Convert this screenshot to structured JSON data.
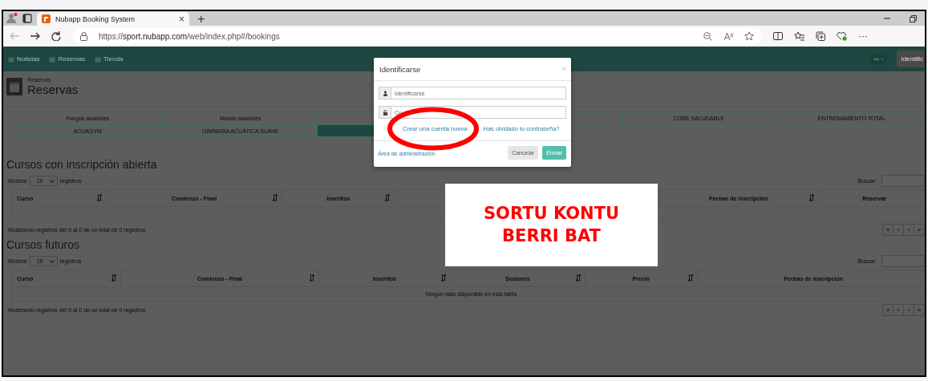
{
  "browser": {
    "tab": {
      "title": "Nubapp Booking System",
      "close": "×",
      "selected": true
    },
    "new_tab": "+",
    "address": {
      "scheme": "https://",
      "host": "sport.nubapp.com",
      "path": "/web/index.php#/bookings"
    },
    "menu": "···"
  },
  "nav": {
    "items": [
      {
        "label": "Noticias"
      },
      {
        "label": "Reservas"
      },
      {
        "label": "Tienda"
      }
    ],
    "login_button": "Identific"
  },
  "header": {
    "breadcrumb": "Reservas",
    "title": "Reservas"
  },
  "categories": [
    [
      {
        "label": "Fuegos asadores",
        "selected": false
      },
      {
        "label": "Mesas asadores",
        "selected": false
      },
      {
        "selected": false
      },
      {
        "selected": false
      },
      {
        "label": "CORE SALUDABLE",
        "selected": false
      },
      {
        "label": "ENTRENAMIENTO TOTAL",
        "selected": false
      }
    ],
    [
      {
        "label": "ACUAGYM",
        "selected": false
      },
      {
        "label": "GIMNASIA ACUÁTICA SUAVE",
        "selected": false
      },
      {
        "selected": true
      }
    ]
  ],
  "sections": [
    {
      "title": "Cursos con inscripción abierta",
      "show_label": "Mostrar",
      "page_size": "10",
      "records_label": "registros",
      "search_label": "Buscar:",
      "columns": [
        {
          "label": "Curso",
          "sortable": true
        },
        {
          "label": "Comienzo - Final",
          "sortable": true
        },
        {
          "label": "Inscritos",
          "sortable": true
        },
        {},
        {
          "label": "Fechas de inscripción",
          "sortable": true
        },
        {
          "label": "Reservar",
          "sortable": false
        }
      ],
      "info": "Mostrando registros del 0 al 0 de un total de 0 registros",
      "pagination": [
        "«",
        "‹",
        "›",
        "»"
      ]
    },
    {
      "title": "Cursos futuros",
      "show_label": "Mostrar",
      "page_size": "10",
      "records_label": "registros",
      "search_label": "Buscar:",
      "columns": [
        {
          "label": "Curso",
          "sortable": true
        },
        {
          "label": "Comienzo - Final",
          "sortable": true
        },
        {
          "label": "Inscritos",
          "sortable": true
        },
        {
          "label": "Sesiones",
          "sortable": true
        },
        {
          "label": "Precio",
          "sortable": true
        },
        {
          "label": "Fechas de inscripción",
          "sortable": false
        }
      ],
      "empty_message": "Ningún dato disponible en esta tabla",
      "info": "Mostrando registros del 0 al 0 de un total de 0 registros",
      "pagination": [
        "«",
        "‹",
        "›",
        "»"
      ]
    }
  ],
  "modal": {
    "title": "Identificarse",
    "close": "×",
    "fields": [
      {
        "kind": "user",
        "placeholder": "Identificarse"
      },
      {
        "kind": "password",
        "placeholder": "Co"
      }
    ],
    "links": [
      "Crear una cuenta nueva",
      "Has olvidado tu contraseña?"
    ],
    "admin_link": "Área de administración",
    "buttons": [
      {
        "label": "Cancelar",
        "kind": "secondary"
      },
      {
        "label": "Enviar",
        "kind": "primary"
      }
    ]
  },
  "note": {
    "lines": [
      "SORTU KONTU",
      "BERRI BAT"
    ]
  }
}
